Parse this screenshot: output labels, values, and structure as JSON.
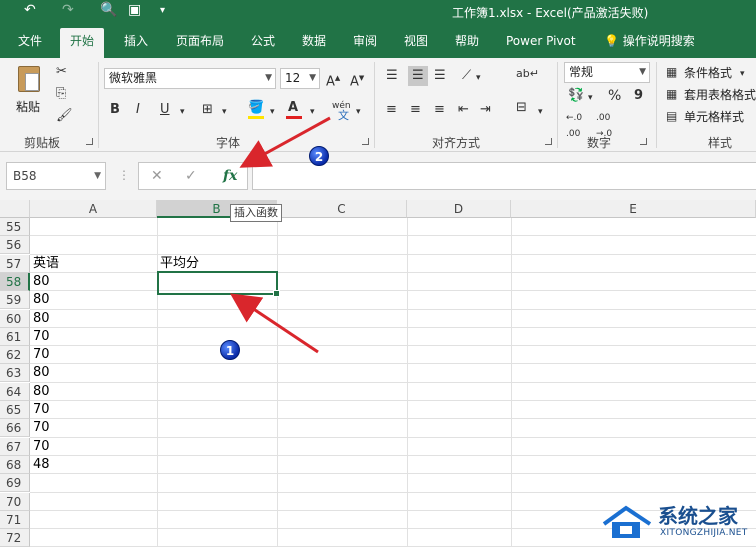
{
  "title_bar": {
    "title": "工作簿1.xlsx - Excel(产品激活失败)"
  },
  "tabs": [
    "文件",
    "开始",
    "插入",
    "页面布局",
    "公式",
    "数据",
    "审阅",
    "视图",
    "帮助",
    "Power Pivot",
    "操作说明搜索"
  ],
  "active_tab": "开始",
  "ribbon": {
    "clipboard": {
      "paste": "粘贴",
      "group": "剪贴板"
    },
    "font": {
      "name": "微软雅黑",
      "size": "12",
      "bold": "B",
      "italic": "I",
      "underline": "U",
      "wen": "wén",
      "group": "字体"
    },
    "alignment": {
      "group": "对齐方式"
    },
    "number": {
      "format": "常规",
      "percent": "%",
      "comma": "9",
      "group": "数字"
    },
    "styles": {
      "conditional": "条件格式",
      "table": "套用表格格式",
      "cell": "单元格样式",
      "group": "样式"
    }
  },
  "formula_bar": {
    "name_box": "B58",
    "fx": "fx",
    "tooltip": "插入函数"
  },
  "columns": [
    "A",
    "B",
    "C",
    "D",
    "E"
  ],
  "rows": [
    {
      "num": "55",
      "a": "",
      "b": ""
    },
    {
      "num": "56",
      "a": "",
      "b": ""
    },
    {
      "num": "57",
      "a": "英语",
      "b": "平均分"
    },
    {
      "num": "58",
      "a": "80",
      "b": ""
    },
    {
      "num": "59",
      "a": "80",
      "b": ""
    },
    {
      "num": "60",
      "a": "80",
      "b": ""
    },
    {
      "num": "61",
      "a": "70",
      "b": ""
    },
    {
      "num": "62",
      "a": "70",
      "b": ""
    },
    {
      "num": "63",
      "a": "80",
      "b": ""
    },
    {
      "num": "64",
      "a": "80",
      "b": ""
    },
    {
      "num": "65",
      "a": "70",
      "b": ""
    },
    {
      "num": "66",
      "a": "70",
      "b": ""
    },
    {
      "num": "67",
      "a": "70",
      "b": ""
    },
    {
      "num": "68",
      "a": "48",
      "b": ""
    },
    {
      "num": "69",
      "a": "",
      "b": ""
    },
    {
      "num": "70",
      "a": "",
      "b": ""
    },
    {
      "num": "71",
      "a": "",
      "b": ""
    },
    {
      "num": "72",
      "a": "",
      "b": ""
    }
  ],
  "markers": [
    "1",
    "2"
  ],
  "watermark": {
    "title": "系统之家",
    "sub": "XITONGZHIJIA.NET"
  },
  "colors": {
    "accent": "#217346",
    "arrow": "#d9262c",
    "marker": "#0a2ba8"
  }
}
